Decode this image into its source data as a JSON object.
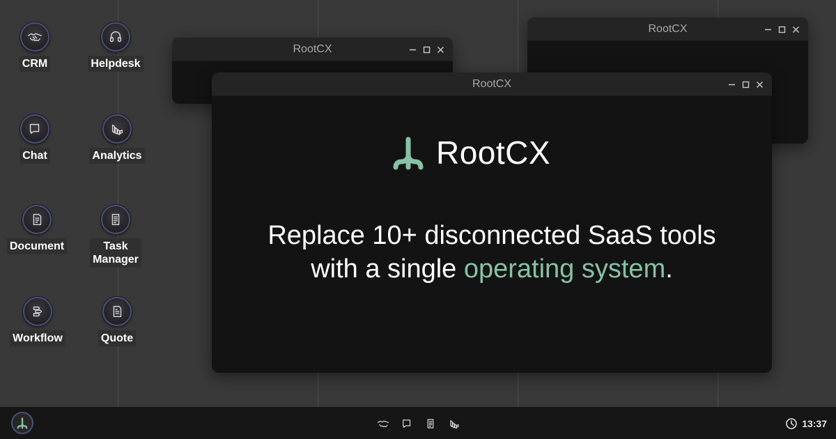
{
  "desktop": {
    "icons": [
      {
        "label": "CRM",
        "icon": "handshake-icon"
      },
      {
        "label": "Helpdesk",
        "icon": "headset-icon"
      },
      {
        "label": "Chat",
        "icon": "chat-bubble-icon"
      },
      {
        "label": "Analytics",
        "icon": "analytics-icon"
      },
      {
        "label": "Document",
        "icon": "document-icon"
      },
      {
        "label": "Task\nManager",
        "icon": "task-list-icon"
      },
      {
        "label": "Workflow",
        "icon": "workflow-icon"
      },
      {
        "label": "Quote",
        "icon": "quote-document-icon"
      }
    ]
  },
  "windows": {
    "back_left": {
      "title": "RootCX"
    },
    "back_right": {
      "title": "RootCX"
    },
    "main": {
      "title": "RootCX",
      "brand_name": "RootCX",
      "tagline_line1": "Replace 10+ disconnected SaaS tools",
      "tagline_line2_prefix": "with a single ",
      "tagline_highlight": "operating system",
      "tagline_suffix": "."
    }
  },
  "taskbar": {
    "apps": [
      "handshake-icon",
      "chat-bubble-icon",
      "task-list-icon",
      "analytics-icon"
    ],
    "clock": "13:37"
  },
  "colors": {
    "desktop_bg": "#393939",
    "window_bg": "#131313",
    "titlebar_bg": "#242424",
    "accent_green": "#87c2a5",
    "taskbar_bg": "#161616"
  }
}
